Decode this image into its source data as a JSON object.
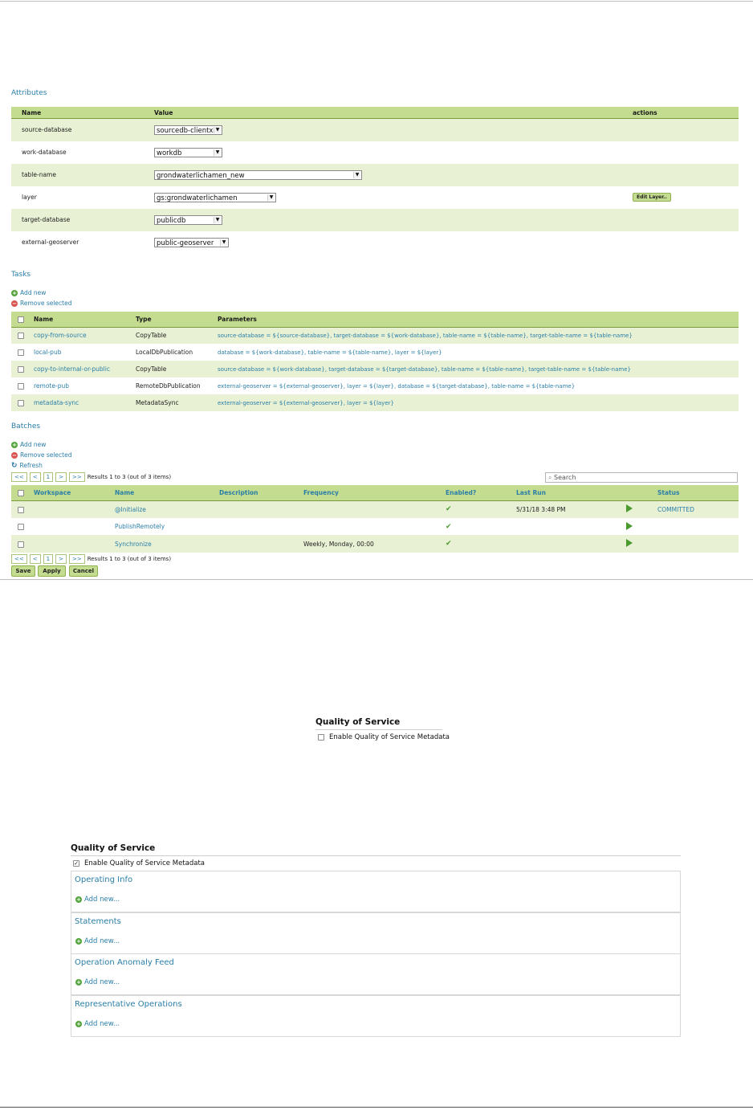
{
  "attributes": {
    "title": "Attributes",
    "headers": {
      "name": "Name",
      "value": "Value",
      "actions": "actions"
    },
    "rows": [
      {
        "name": "source-database",
        "value": "sourcedb-clientx",
        "action": ""
      },
      {
        "name": "work-database",
        "value": "workdb",
        "action": ""
      },
      {
        "name": "table-name",
        "value": "grondwaterlichamen_new",
        "action": ""
      },
      {
        "name": "layer",
        "value": "gs:grondwaterlichamen",
        "action": "Edit Layer.."
      },
      {
        "name": "target-database",
        "value": "publicdb",
        "action": ""
      },
      {
        "name": "external-geoserver",
        "value": "public-geoserver",
        "action": ""
      }
    ]
  },
  "tasks": {
    "title": "Tasks",
    "add_new": "Add new",
    "remove_selected": "Remove selected",
    "headers": {
      "name": "Name",
      "type": "Type",
      "parameters": "Parameters"
    },
    "rows": [
      {
        "name": "copy-from-source",
        "type": "CopyTable",
        "parameters": "source-database = ${source-database}, target-database = ${work-database}, table-name = ${table-name}, target-table-name = ${table-name}"
      },
      {
        "name": "local-pub",
        "type": "LocalDbPublication",
        "parameters": "database = ${work-database}, table-name = ${table-name}, layer = ${layer}"
      },
      {
        "name": "copy-to-internal-or-public",
        "type": "CopyTable",
        "parameters": "source-database = ${work-database}, target-database = ${target-database}, table-name = ${table-name}, target-table-name = ${table-name}"
      },
      {
        "name": "remote-pub",
        "type": "RemoteDbPublication",
        "parameters": "external-geoserver = ${external-geoserver}, layer = ${layer}, database = ${target-database}, table-name = ${table-name}"
      },
      {
        "name": "metadata-sync",
        "type": "MetadataSync",
        "parameters": "external-geoserver = ${external-geoserver}, layer = ${layer}"
      }
    ]
  },
  "batches": {
    "title": "Batches",
    "add_new": "Add new",
    "remove_selected": "Remove selected",
    "refresh": "Refresh",
    "pager": {
      "first": "<<",
      "prev": "<",
      "page": "1",
      "next": ">",
      "last": ">>",
      "results": "Results 1 to 3 (out of 3 items)"
    },
    "search_placeholder": "Search",
    "headers": {
      "workspace": "Workspace",
      "name": "Name",
      "description": "Description",
      "frequency": "Frequency",
      "enabled": "Enabled?",
      "last_run": "Last Run",
      "status": "Status"
    },
    "rows": [
      {
        "workspace": "",
        "name": "@Initialize",
        "description": "",
        "frequency": "",
        "enabled": "✔",
        "last_run": "5/31/18 3:48 PM",
        "status": "COMMITTED"
      },
      {
        "workspace": "",
        "name": "PublishRemotely",
        "description": "",
        "frequency": "",
        "enabled": "✔",
        "last_run": "",
        "status": ""
      },
      {
        "workspace": "",
        "name": "Synchronize",
        "description": "",
        "frequency": "Weekly, Monday, 00:00",
        "enabled": "✔",
        "last_run": "",
        "status": ""
      }
    ]
  },
  "buttons": {
    "save": "Save",
    "apply": "Apply",
    "cancel": "Cancel"
  },
  "qos_small": {
    "title": "Quality of Service",
    "checkbox_label": "Enable Quality of Service Metadata",
    "checked": false
  },
  "qos_large": {
    "title": "Quality of Service",
    "checkbox_label": "Enable Quality of Service Metadata",
    "checked": true,
    "panels": [
      {
        "title": "Operating Info",
        "add": "Add new..."
      },
      {
        "title": "Statements",
        "add": "Add new..."
      },
      {
        "title": "Operation Anomaly Feed",
        "add": "Add new..."
      },
      {
        "title": "Representative Operations",
        "add": "Add new..."
      }
    ]
  },
  "colors": {
    "header_green": "#c4dc8f",
    "row_green": "#e8f1d4",
    "link_blue": "#2a7ea8",
    "check_green": "#4a9a2e"
  }
}
